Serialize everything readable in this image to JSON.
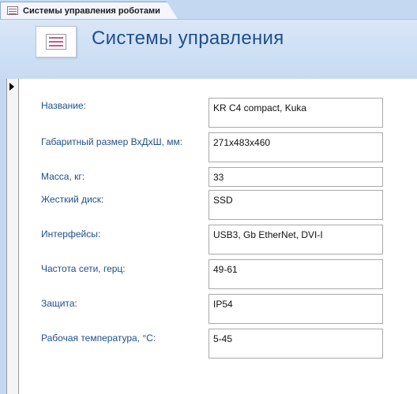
{
  "tab": {
    "label": "Системы управления роботами",
    "icon": "form-icon"
  },
  "header": {
    "title": "Системы управления",
    "icon": "form-icon"
  },
  "fields": [
    {
      "label": "Название:",
      "value": "KR C4 compact, Kuka"
    },
    {
      "label": "Габаритный размер ВхДхШ, мм:",
      "value": "271x483x460"
    },
    {
      "label": "Масса, кг:",
      "value": "33"
    },
    {
      "label": "Жесткий диск:",
      "value": "SSD"
    },
    {
      "label": "Интерфейсы:",
      "value": "USB3, Gb EtherNet, DVI-I"
    },
    {
      "label": "Частота сети, герц:",
      "value": "49-61"
    },
    {
      "label": "Защита:",
      "value": "IP54"
    },
    {
      "label": "Рабочая температура, °С:",
      "value": "5-45"
    }
  ]
}
